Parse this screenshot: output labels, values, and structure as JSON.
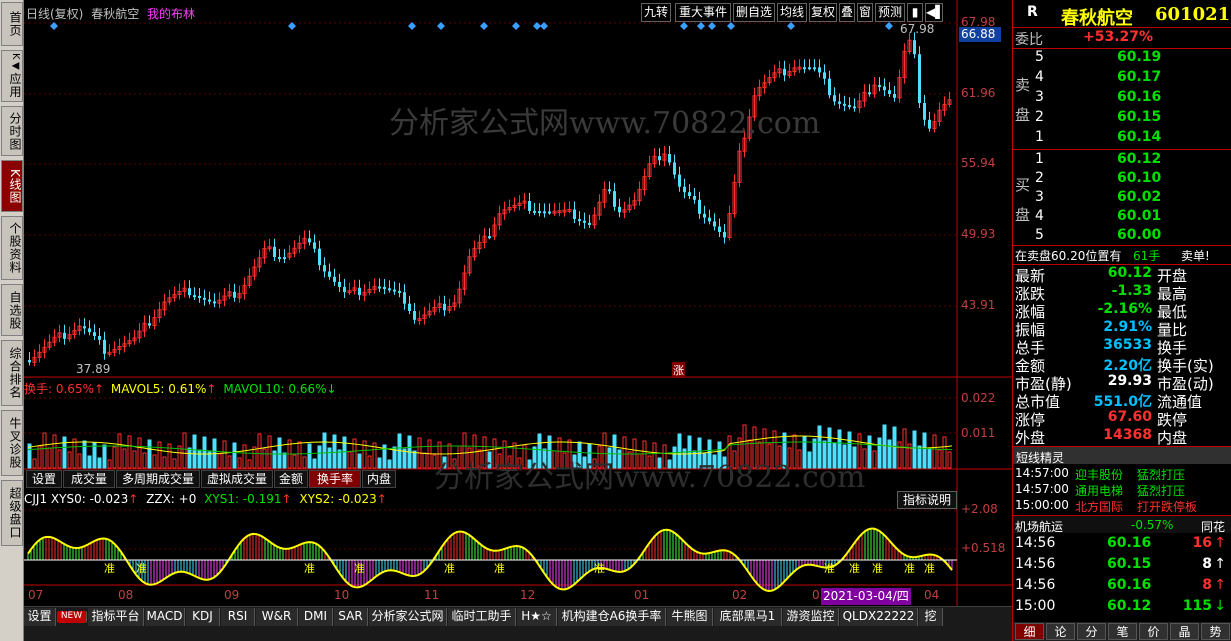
{
  "left_nav": [
    {
      "label": "首页",
      "active": false
    },
    {
      "label": "应用",
      "active": false,
      "prefix": "K◀"
    },
    {
      "label": "分时图",
      "active": false
    },
    {
      "label": "K线图",
      "active": true
    },
    {
      "label": "个股资料",
      "active": false
    },
    {
      "label": "自选股",
      "active": false
    },
    {
      "label": "综合排名",
      "active": false
    },
    {
      "label": "牛叉诊股",
      "active": false
    },
    {
      "label": "超级盘口",
      "active": false
    }
  ],
  "top": {
    "period": "日线(复权)",
    "stock": "春秋航空",
    "category": "我的布林"
  },
  "toolbar": [
    "九转",
    "重大事件",
    "删自选",
    "均线",
    "复权",
    "叠",
    "窗",
    "预测"
  ],
  "toolbar_icons": [
    "sidebar-toggle-icon",
    "arrow-left-icon"
  ],
  "watermark": "分析家公式网www.70822.com",
  "watermark2": "分析家公式网www.70822.com",
  "main_chart": {
    "price_labels": [
      "67.98",
      "61.96",
      "55.94",
      "49.93",
      "43.91"
    ],
    "current_price_tag": "66.88",
    "high_marker": "67.98",
    "low_marker": "37.89",
    "zhang_label": "涨",
    "accent_colors": {
      "up": "#ff3030",
      "down": "#4fe0ff",
      "marker": "#3aa0ff"
    }
  },
  "volume_pane": {
    "legend_name": "换手: 0.65%",
    "legend_arrow1": "↑",
    "ma5": "MAVOL5: 0.61%",
    "ma5_arrow": "↑",
    "ma10": "MAVOL10: 0.66%",
    "ma10_arrow": "↓",
    "y_labels": [
      "0.022",
      "0.011"
    ]
  },
  "mid_tabs": [
    "设置",
    "成交量",
    "多周期成交量",
    "虚拟成交量",
    "金额",
    "换手率",
    "内盘"
  ],
  "mid_tabs_active": "换手率",
  "indicator_pane": {
    "legend1": "CJJ1 XYS0: -0.023",
    "arrow1": "↑",
    "legend2": "ZZX: +0",
    "legend3": "XYS1: -0.191",
    "arrow3": "↑",
    "legend4": "XYS2: -0.023",
    "arrow4": "↑",
    "explain_button": "指标说明",
    "y_labels": [
      "+2.08",
      "+0.518"
    ],
    "zhun_label": "准"
  },
  "x_axis": {
    "labels": [
      "07",
      "08",
      "09",
      "10",
      "11",
      "12",
      "01",
      "02",
      "03",
      "04"
    ],
    "cursor_date": "2021-03-04/四"
  },
  "bottom_tabs": [
    "设置",
    "NEW",
    "指标平台",
    "MACD",
    "KDJ",
    "RSI",
    "W&R",
    "DMI",
    "SAR",
    "分析家公式网",
    "临时工助手",
    "H★☆",
    "机构建仓A6换手率",
    "牛熊图",
    "底部黑马1",
    "游资监控",
    "QLDX22222",
    "挖"
  ],
  "right": {
    "header_r": "R",
    "name": "春秋航空",
    "code": "601021",
    "weibi_label": "委比",
    "weibi_value": "+53.27%",
    "sell_label": "卖盘",
    "buy_label": "买盘",
    "sell": [
      {
        "n": "5",
        "p": "60.19"
      },
      {
        "n": "4",
        "p": "60.17"
      },
      {
        "n": "3",
        "p": "60.16"
      },
      {
        "n": "2",
        "p": "60.15"
      },
      {
        "n": "1",
        "p": "60.14"
      }
    ],
    "buy": [
      {
        "n": "1",
        "p": "60.12"
      },
      {
        "n": "2",
        "p": "60.10"
      },
      {
        "n": "3",
        "p": "60.02"
      },
      {
        "n": "4",
        "p": "60.01"
      },
      {
        "n": "5",
        "p": "60.00"
      }
    ],
    "notice_left": "在卖盘60.20位置有",
    "notice_qty": "61手",
    "notice_right": "卖单!",
    "stats": [
      {
        "k": "最新",
        "v": "60.12",
        "c": "green",
        "k2": "开盘"
      },
      {
        "k": "涨跌",
        "v": "-1.33",
        "c": "green",
        "k2": "最高"
      },
      {
        "k": "涨幅",
        "v": "-2.16%",
        "c": "green",
        "k2": "最低"
      },
      {
        "k": "振幅",
        "v": "2.91%",
        "c": "cyan",
        "k2": "量比"
      },
      {
        "k": "总手",
        "v": "36533",
        "c": "cyan",
        "k2": "换手"
      },
      {
        "k": "金额",
        "v": "2.20亿",
        "c": "cyan",
        "k2": "换手(实)"
      },
      {
        "k": "市盈(静)",
        "v": "29.93",
        "c": "white",
        "k2": "市盈(动)"
      },
      {
        "k": "总市值",
        "v": "551.0亿",
        "c": "cyan",
        "k2": "流通值"
      },
      {
        "k": "涨停",
        "v": "67.60",
        "c": "red",
        "k2": "跌停"
      },
      {
        "k": "外盘",
        "v": "14368",
        "c": "red",
        "k2": "内盘"
      }
    ],
    "spirit_title": "短线精灵",
    "spirit": [
      {
        "t": "14:57:00",
        "s": "迎丰股份",
        "e": "猛烈打压",
        "c": "green"
      },
      {
        "t": "14:57:00",
        "s": "通用电梯",
        "e": "猛烈打压",
        "c": "green"
      },
      {
        "t": "15:00:00",
        "s": "北方国际",
        "e": "打开跌停板",
        "c": "red"
      }
    ],
    "sector_name": "机场航运",
    "sector_change": "-0.57%",
    "sector_more": "同花",
    "ticks": [
      {
        "t": "14:56",
        "p": "60.16",
        "q": "16",
        "a": "↑",
        "c": "red"
      },
      {
        "t": "14:56",
        "p": "60.15",
        "q": "8",
        "a": "↑",
        "c": "white"
      },
      {
        "t": "14:56",
        "p": "60.16",
        "q": "8",
        "a": "↑",
        "c": "red"
      },
      {
        "t": "15:00",
        "p": "60.12",
        "q": "115",
        "a": "↓",
        "c": "green"
      }
    ],
    "bottom_tabs": [
      "细",
      "论",
      "分",
      "笔",
      "价",
      "晶",
      "势"
    ]
  }
}
